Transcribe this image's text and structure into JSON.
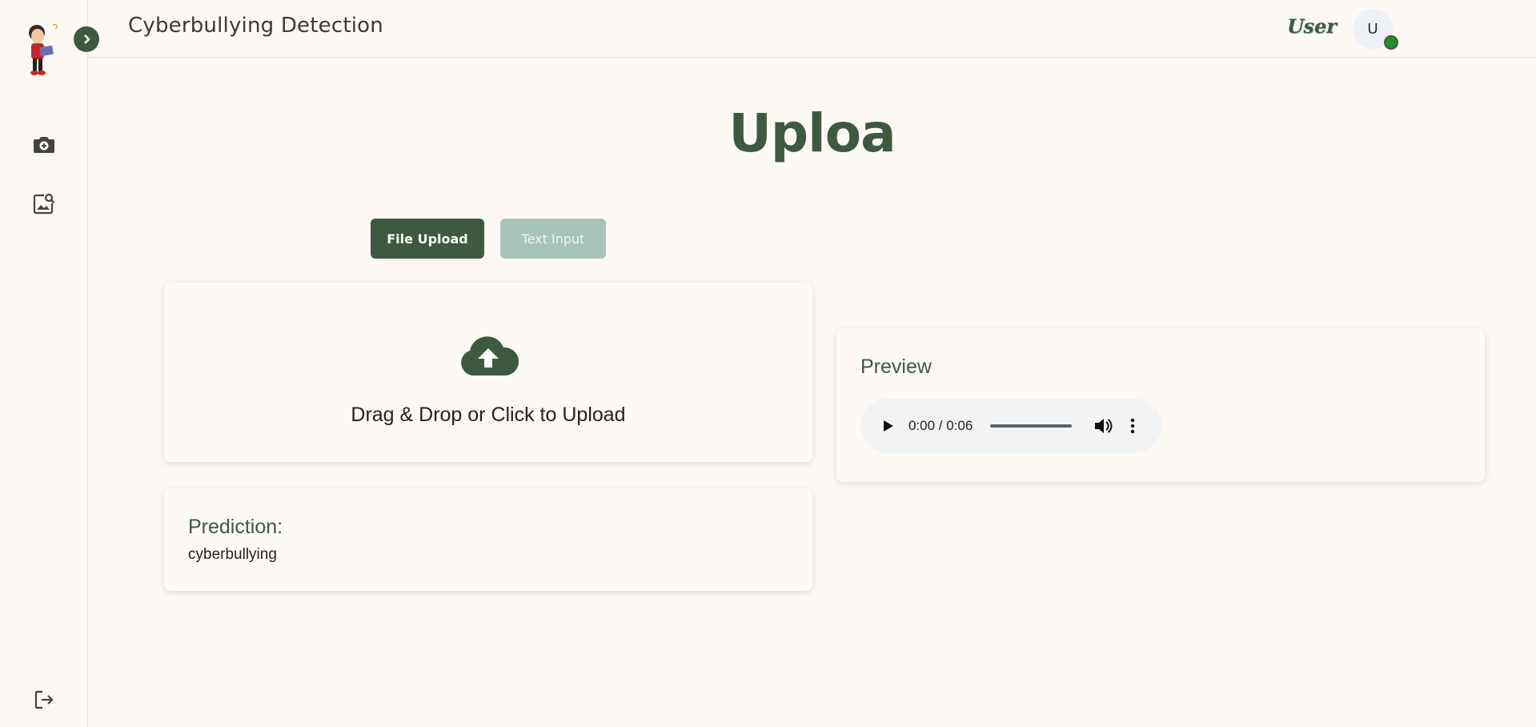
{
  "header": {
    "app_title": "Cyberbullying Detection",
    "user_label": "User",
    "avatar_initial": "U"
  },
  "sidebar": {
    "items": [
      {
        "icon": "camera-plus-icon"
      },
      {
        "icon": "image-search-icon"
      },
      {
        "icon": "logout-icon"
      }
    ]
  },
  "main": {
    "heading": "Uploa",
    "tabs": [
      {
        "label": "File Upload",
        "active": true
      },
      {
        "label": "Text Input",
        "active": false
      }
    ],
    "upload": {
      "icon": "cloud-upload-icon",
      "text": "Drag & Drop or Click to Upload"
    },
    "prediction": {
      "label": "Prediction:",
      "value": "cyberbullying"
    },
    "preview": {
      "label": "Preview",
      "audio": {
        "time": "0:00 / 0:06",
        "progress": 0
      }
    }
  },
  "colors": {
    "accent": "#3d5a40",
    "accent_light": "#a7c4ba",
    "background": "#fcf8f4",
    "status_online": "#1f8f2a"
  }
}
